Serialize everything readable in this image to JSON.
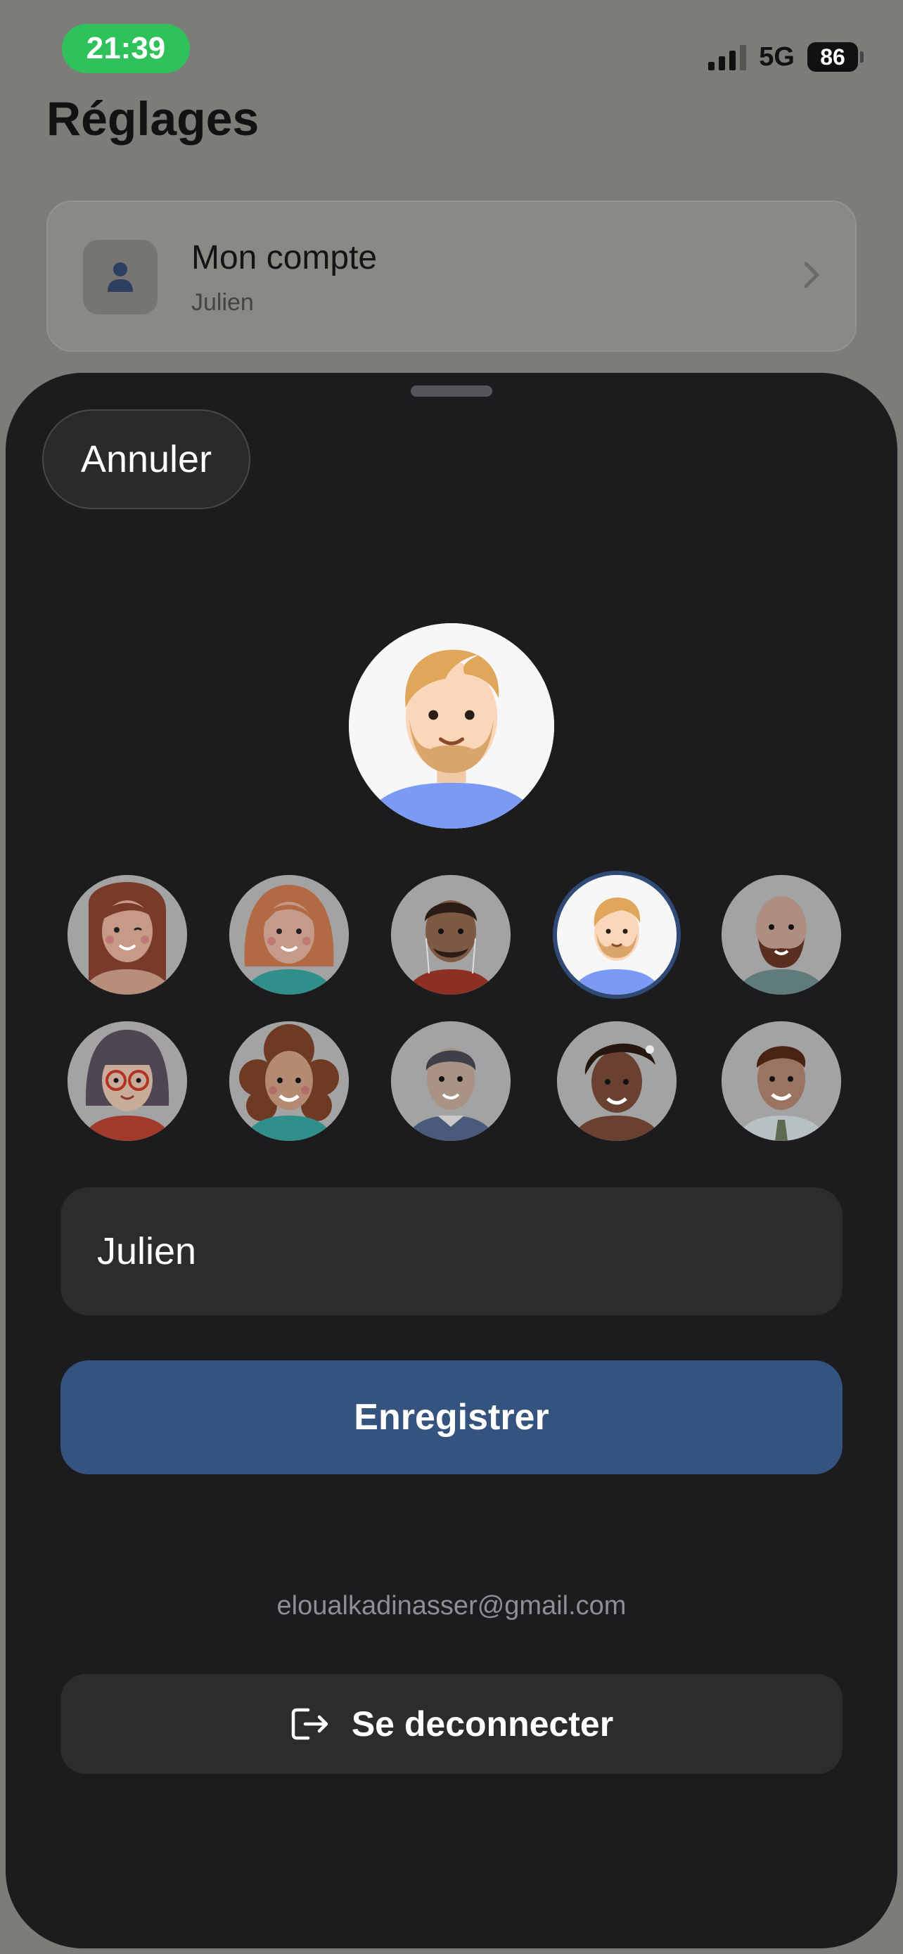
{
  "status_bar": {
    "time": "21:39",
    "network": "5G",
    "battery": "86"
  },
  "settings": {
    "title": "Réglages",
    "account": {
      "title": "Mon compte",
      "subtitle": "Julien"
    }
  },
  "sheet": {
    "cancel_label": "Annuler",
    "selected_avatar": "man-blond-beard",
    "avatars": [
      "woman-auburn-winking",
      "woman-red-hair",
      "man-dark-beard-earphones",
      "man-blond-beard",
      "man-bald-beard",
      "woman-bob-glasses",
      "woman-curly-brown",
      "man-gray-hair",
      "woman-dark-skin-hair-clip",
      "man-brown-hair-tie"
    ],
    "name_value": "Julien",
    "name_placeholder": "",
    "save_label": "Enregistrer",
    "email": "eloualkadinasser@gmail.com",
    "logout_label": "Se deconnecter"
  },
  "colors": {
    "status_pill": "#2fc25a",
    "sheet_bg": "#1c1c1e",
    "save_button": "#34547f",
    "selected_ring": "#2f4a75"
  }
}
